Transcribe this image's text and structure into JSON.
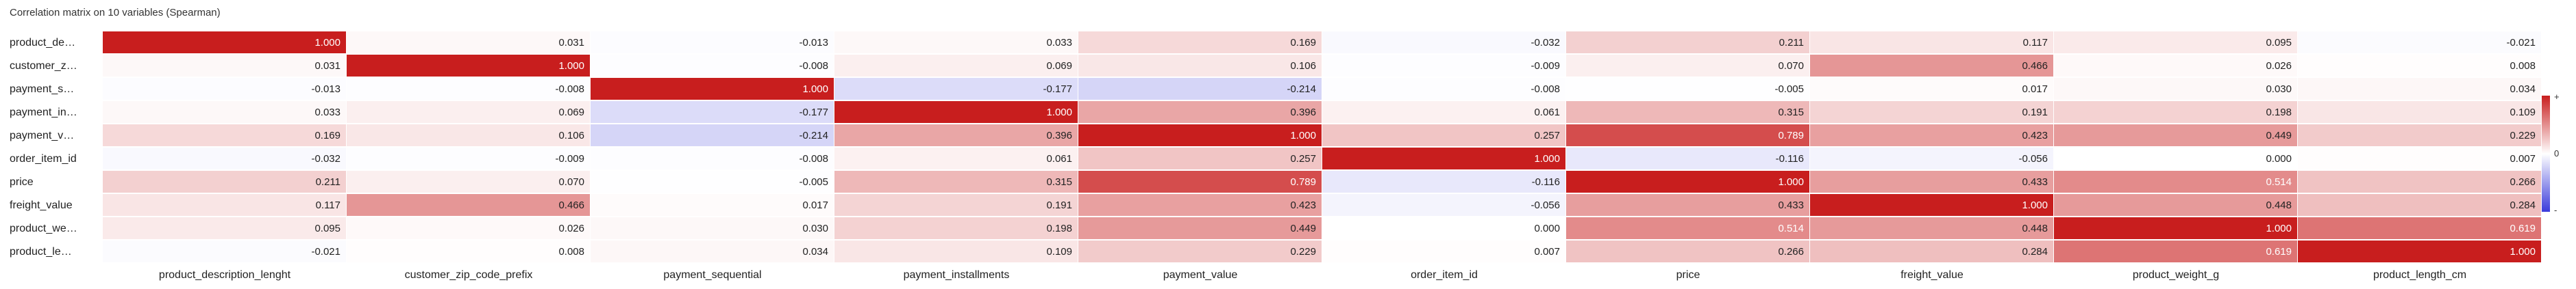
{
  "title": "Correlation matrix on 10 variables (Spearman)",
  "colors": {
    "positive": "#c81e1e",
    "negative": "#3b3bdb",
    "neutral": "#ffffff"
  },
  "legend": {
    "top": "+",
    "middle": "0",
    "bottom": "-"
  },
  "row_labels": [
    "product_de…",
    "customer_z…",
    "payment_s…",
    "payment_in…",
    "payment_v…",
    "order_item_id",
    "price",
    "freight_value",
    "product_we…",
    "product_le…"
  ],
  "chart_data": {
    "type": "heatmap",
    "title": "Correlation matrix on 10 variables (Spearman)",
    "variables": [
      "product_description_lenght",
      "customer_zip_code_prefix",
      "payment_sequential",
      "payment_installments",
      "payment_value",
      "order_item_id",
      "price",
      "freight_value",
      "product_weight_g",
      "product_length_cm"
    ],
    "range": [
      -1,
      1
    ],
    "values": [
      [
        1.0,
        0.031,
        -0.013,
        0.033,
        0.169,
        -0.032,
        0.211,
        0.117,
        0.095,
        -0.021
      ],
      [
        0.031,
        1.0,
        -0.008,
        0.069,
        0.106,
        -0.009,
        0.07,
        0.466,
        0.026,
        0.008
      ],
      [
        -0.013,
        -0.008,
        1.0,
        -0.177,
        -0.214,
        -0.008,
        -0.005,
        0.017,
        0.03,
        0.034
      ],
      [
        0.033,
        0.069,
        -0.177,
        1.0,
        0.396,
        0.061,
        0.315,
        0.191,
        0.198,
        0.109
      ],
      [
        0.169,
        0.106,
        -0.214,
        0.396,
        1.0,
        0.257,
        0.789,
        0.423,
        0.449,
        0.229
      ],
      [
        -0.032,
        -0.009,
        -0.008,
        0.061,
        0.257,
        1.0,
        -0.116,
        -0.056,
        0.0,
        0.007
      ],
      [
        0.211,
        0.07,
        -0.005,
        0.315,
        0.789,
        -0.116,
        1.0,
        0.433,
        0.514,
        0.266
      ],
      [
        0.117,
        0.466,
        0.017,
        0.191,
        0.423,
        -0.056,
        0.433,
        1.0,
        0.448,
        0.284
      ],
      [
        0.095,
        0.026,
        0.03,
        0.198,
        0.449,
        0.0,
        0.514,
        0.448,
        1.0,
        0.619
      ],
      [
        -0.021,
        0.008,
        0.034,
        0.109,
        0.229,
        0.007,
        0.266,
        0.284,
        0.619,
        1.0
      ]
    ]
  }
}
